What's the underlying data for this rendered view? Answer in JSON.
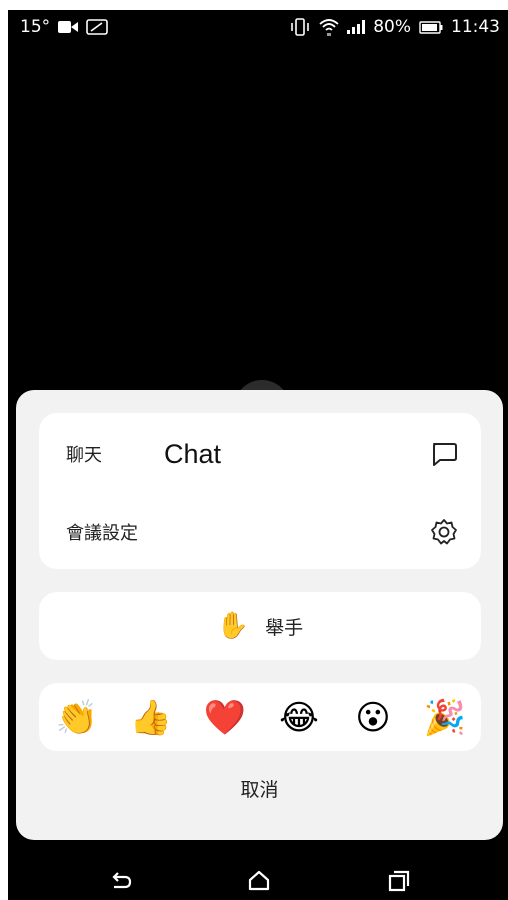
{
  "status_bar": {
    "temperature": "15°",
    "battery_percent": "80%",
    "time": "11:43",
    "left_icons": [
      "video-call-icon",
      "sim-card-icon"
    ],
    "right_icons": [
      "vibrate-icon",
      "wifi-icon",
      "signal-icon",
      "battery-icon"
    ]
  },
  "sheet": {
    "menu": [
      {
        "label": "聊天",
        "icon": "chat-bubble-icon"
      },
      {
        "label": "會議設定",
        "icon": "gear-icon"
      }
    ],
    "chat_overlay_text": "Chat",
    "raise_hand": {
      "emoji": "✋",
      "label": "舉手"
    },
    "reactions": [
      "👏",
      "👍",
      "❤️",
      "😂",
      "😮",
      "🎉"
    ],
    "cancel_label": "取消"
  },
  "nav_bar": {
    "icons": [
      "back-icon",
      "home-icon",
      "recents-icon"
    ]
  },
  "colors": {
    "background": "#000000",
    "sheet": "#f2f2f2",
    "card": "#ffffff"
  }
}
